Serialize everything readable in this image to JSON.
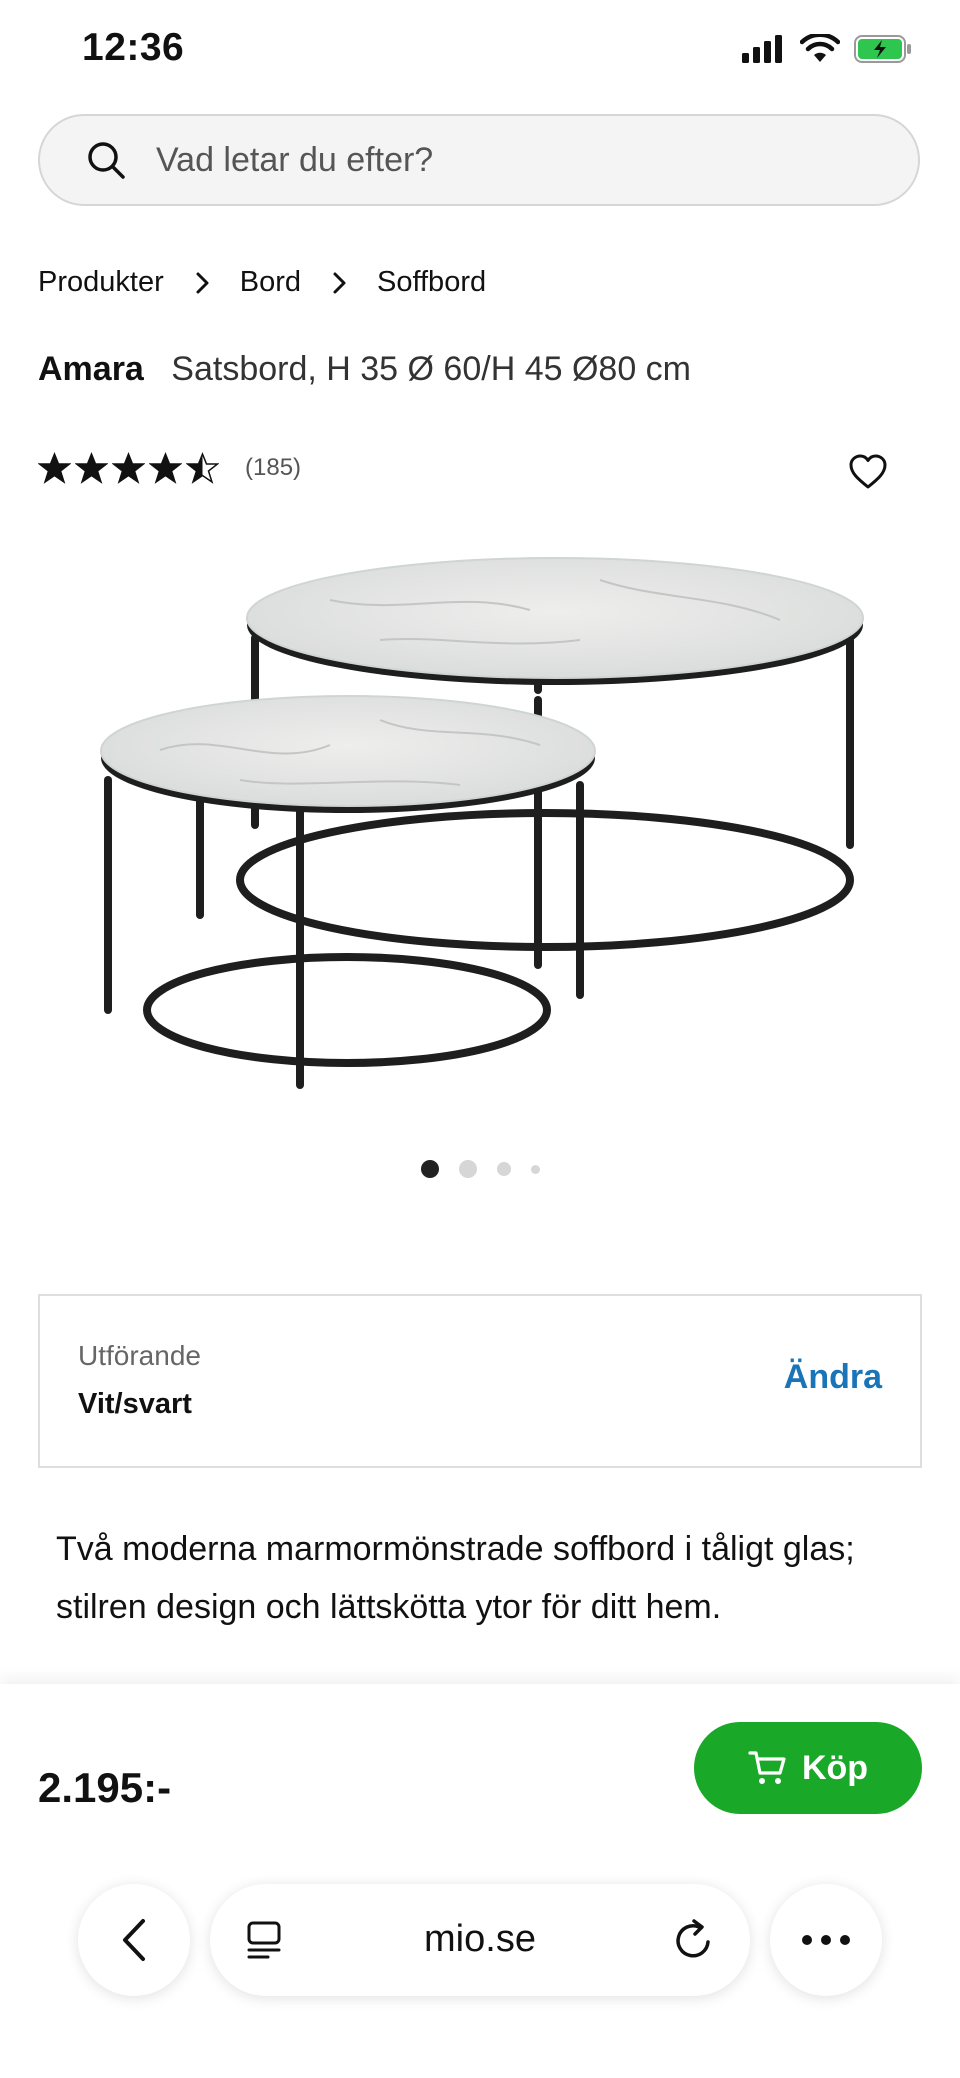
{
  "status_bar": {
    "time": "12:36"
  },
  "search": {
    "placeholder": "Vad letar du efter?"
  },
  "breadcrumb": {
    "items": [
      "Produkter",
      "Bord",
      "Soffbord"
    ]
  },
  "product": {
    "brand": "Amara",
    "description": "Satsbord, H 35 Ø 60/H 45 Ø80 cm",
    "rating_count": "(185)",
    "rating_value": 4.5,
    "rating_max": 5
  },
  "gallery": {
    "total_images": 4,
    "current_index": 1
  },
  "variant": {
    "label": "Utförande",
    "value": "Vit/svart",
    "change_label": "Ändra"
  },
  "details": {
    "text": "Två moderna marmormönstrade soffbord i tåligt glas; stilren design och lättskötta ytor för ditt hem."
  },
  "purchase": {
    "price": "2.195:-",
    "buy_label": "Köp"
  },
  "browser": {
    "url": "mio.se"
  },
  "colors": {
    "buy_button": "#1aa829",
    "link": "#1a74b8",
    "background": "#ffffff"
  },
  "icons": {
    "search": "search-icon",
    "breadcrumb_separator": "chevron-right-icon",
    "favorite": "heart-icon",
    "cart": "cart-icon",
    "back": "chevron-left-icon",
    "tabs": "tabs-icon",
    "reload": "reload-icon",
    "more": "more-icon"
  }
}
